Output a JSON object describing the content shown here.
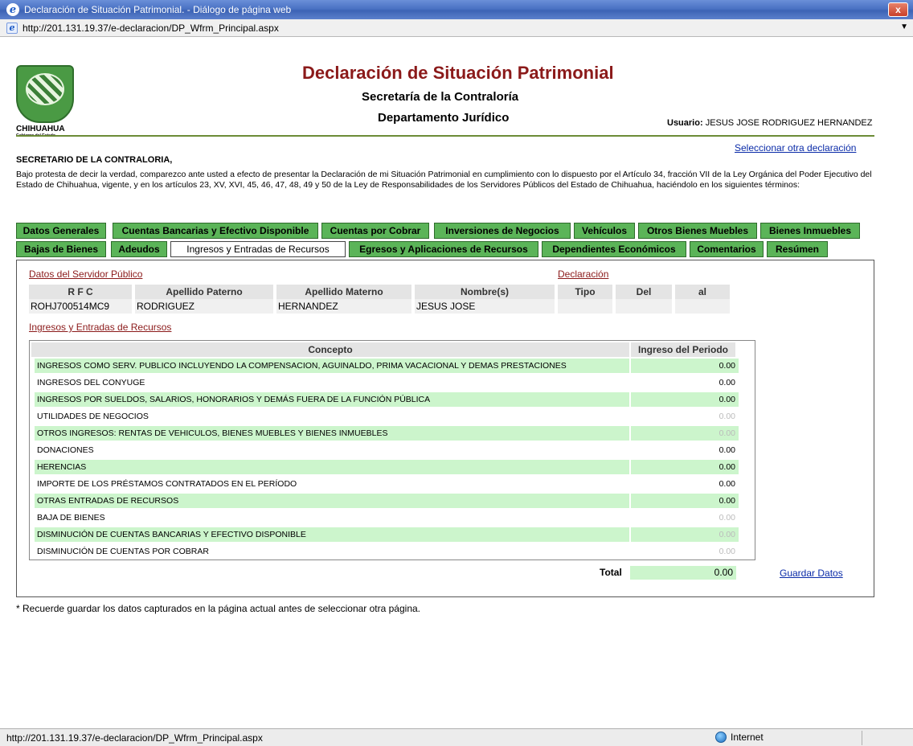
{
  "window": {
    "title": "Declaración de Situación Patrimonial. - Diálogo de página web",
    "close_label": "x",
    "url": "http://201.131.19.37/e-declaracion/DP_Wfrm_Principal.aspx"
  },
  "status": {
    "url": "http://201.131.19.37/e-declaracion/DP_Wfrm_Principal.aspx",
    "zone": "Internet"
  },
  "header": {
    "logo_text": "CHIHUAHUA",
    "logo_sub": "Gobierno del Estado",
    "title": "Declaración de Situación Patrimonial",
    "subtitle1": "Secretaría de la Contraloría",
    "subtitle2": "Departamento Jurídico",
    "user_label": "Usuario:",
    "user_name": "JESUS JOSE RODRIGUEZ HERNANDEZ",
    "select_other": "Seleccionar otra declaración"
  },
  "intro": {
    "addressee": "SECRETARIO DE LA CONTRALORIA,",
    "text": "Bajo protesta de decir la verdad, comparezco ante usted a efecto de presentar la Declaración de mi Situación Patrimonial en cumplimiento con lo dispuesto por el Artículo 34, fracción VII de la Ley Orgánica del Poder Ejecutivo del Estado de Chihuahua, vigente, y en los artículos 23, XV, XVI, 45, 46, 47, 48, 49 y 50 de la Ley de Responsabilidades de los Servidores Públicos del Estado de Chihuahua, haciéndolo en los siguientes términos:"
  },
  "tabs_row1": [
    "Datos Generales",
    "Cuentas Bancarias y Efectivo Disponible",
    "Cuentas por Cobrar",
    "Inversiones de Negocios",
    "Vehículos",
    "Otros Bienes Muebles",
    "Bienes Inmuebles"
  ],
  "tabs_row2": [
    "Bajas de Bienes",
    "Adeudos",
    "Ingresos y Entradas de Recursos",
    "Egresos y Aplicaciones de Recursos",
    "Dependientes Económicos",
    "Comentarios",
    "Resúmen"
  ],
  "servidor": {
    "section_title": "Datos del Servidor Público",
    "headers": [
      "R F C",
      "Apellido Paterno",
      "Apellido Materno",
      "Nombre(s)"
    ],
    "values": [
      "ROHJ700514MC9",
      "RODRIGUEZ",
      "HERNANDEZ",
      "JESUS JOSE"
    ]
  },
  "declaracion": {
    "section_title": "Declaración",
    "headers": [
      "Tipo",
      "Del",
      "al"
    ]
  },
  "ingresos": {
    "section_title": "Ingresos y Entradas de Recursos",
    "header_concepto": "Concepto",
    "header_ingreso": "Ingreso del Periodo",
    "rows": [
      {
        "concepto": "INGRESOS COMO SERV. PUBLICO INCLUYENDO LA COMPENSACION, AGUINALDO, PRIMA VACACIONAL Y DEMAS PRESTACIONES",
        "valor": "0.00"
      },
      {
        "concepto": "INGRESOS DEL CONYUGE",
        "valor": "0.00"
      },
      {
        "concepto": "INGRESOS POR SUELDOS, SALARIOS, HONORARIOS Y DEMÁS FUERA DE LA FUNCIÓN PÚBLICA",
        "valor": "0.00"
      },
      {
        "concepto": "UTILIDADES DE NEGOCIOS",
        "valor": "0.00"
      },
      {
        "concepto": "OTROS INGRESOS: RENTAS DE VEHICULOS, BIENES MUEBLES Y BIENES INMUEBLES",
        "valor": "0.00"
      },
      {
        "concepto": "DONACIONES",
        "valor": "0.00"
      },
      {
        "concepto": "HERENCIAS",
        "valor": "0.00"
      },
      {
        "concepto": "IMPORTE DE LOS PRÉSTAMOS CONTRATADOS EN EL PERÍODO",
        "valor": "0.00"
      },
      {
        "concepto": "OTRAS ENTRADAS DE RECURSOS",
        "valor": "0.00"
      },
      {
        "concepto": "BAJA DE BIENES",
        "valor": "0.00"
      },
      {
        "concepto": "DISMINUCIÓN DE CUENTAS BANCARIAS Y EFECTIVO DISPONIBLE",
        "valor": "0.00"
      },
      {
        "concepto": "DISMINUCIÓN DE CUENTAS POR COBRAR",
        "valor": "0.00"
      }
    ],
    "total_label": "Total",
    "total_value": "0.00",
    "save_label": "Guardar Datos"
  },
  "footer_note": "* Recuerde guardar los datos capturados en la página actual antes de seleccionar otra página."
}
